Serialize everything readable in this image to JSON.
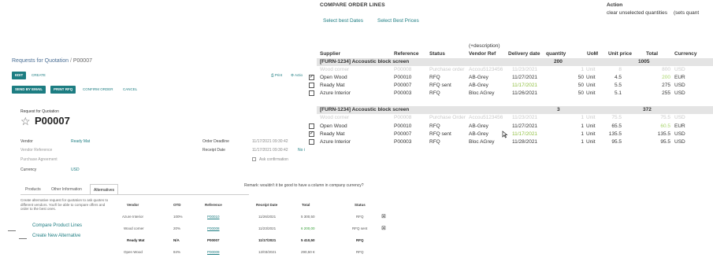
{
  "form": {
    "breadcrumb_parent": "Requests for Quotation",
    "breadcrumb_sep": " / ",
    "breadcrumb_current": "P00007",
    "buttons": {
      "edit": "EDIT",
      "create": "CREATE",
      "send_email": "SEND BY EMAIL",
      "print_rfq": "PRINT RFQ",
      "confirm": "CONFIRM ORDER",
      "cancel": "CANCEL",
      "print": "⎙ Print",
      "action": "⚙ Actio"
    },
    "title_small": "Request for Quotation",
    "title": "P00007",
    "fields": {
      "vendor_label": "Vendor",
      "vendor_value": "Ready Mat",
      "vendor_ref_label": "Vendor Reference",
      "agreement_label": "Purchase Agreement",
      "currency_label": "Currency",
      "currency_value": "USD",
      "deadline_label": "Order Deadline",
      "deadline_value": "11/17/2021 09:30:42",
      "receipt_label": "Receipt Date",
      "receipt_value": "11/17/2021 09:30:42",
      "receipt_extra": "No i",
      "ask_confirm": "Ask confirmation"
    },
    "tabs": [
      "Products",
      "Other Information",
      "Alternatives"
    ],
    "remark": "Remark: wouldn't it be good to have a column in company currency?",
    "note": "Create alternative request for quotation to ask quotes to different vendors. You'll be able to compare offers and order to the best ones.",
    "compare_link": "Compare Product Lines",
    "create_alt_link": "Create New Alternative",
    "alt_table": {
      "headers": [
        "Vendor",
        "OTD",
        "Reference",
        "Receipt Date",
        "Total",
        "Status"
      ],
      "rows": [
        [
          "Azure Interior",
          "100%",
          "P00010",
          "11/26/2021",
          "5 300,50",
          "RFQ"
        ],
        [
          "Wood corner",
          "20%",
          "P00008",
          "11/23/2021",
          "6 200,00",
          "RFQ sent"
        ],
        [
          "Ready Mat",
          "N/A",
          "P00007",
          "11/17/2021",
          "5 410,50",
          "RFQ"
        ],
        [
          "Open Wood",
          "84%",
          "P00009",
          "12/03/2021",
          "290,50 €",
          "RFQ"
        ]
      ]
    }
  },
  "compare": {
    "title": "COMPARE ORDER LINES",
    "action_label": "Action",
    "action_text": "clear unselected quantities",
    "action_text2": "(sets quant",
    "select_best_dates": "Select best Dates",
    "select_best_prices": "Select Best Prices",
    "description_hint": "(+description)",
    "headers": [
      "Supplier",
      "Reference",
      "Status",
      "Vendor Ref",
      "Delivery date",
      "quantity",
      "UoM",
      "Unit price",
      "Total",
      "Currency"
    ],
    "groups": [
      {
        "product": "[FURN-1234] Accoustic block screen",
        "qty": "200",
        "total": "1005",
        "faded": [
          "Wood corner",
          "P00008",
          "Purchase order",
          "Accou5123456",
          "11/23/2021",
          "1",
          "Unit",
          "8",
          "800",
          "USD"
        ],
        "lines": [
          {
            "checked": true,
            "supplier": "Open Wood",
            "ref": "P00010",
            "status": "RFQ",
            "vref": "AB-Grey",
            "date": "11/27/2021",
            "qty": "50",
            "uom": "Unit",
            "price": "4.5",
            "total": "200",
            "currency": "EUR",
            "date_hl": false,
            "total_hl": true
          },
          {
            "checked": false,
            "supplier": "Ready Mat",
            "ref": "P00007",
            "status": "RFQ sent",
            "vref": "AB-Grey",
            "date": "11/17/2021",
            "qty": "50",
            "uom": "Unit",
            "price": "5.5",
            "total": "275",
            "currency": "USD",
            "date_hl": true,
            "total_hl": false
          },
          {
            "checked": false,
            "supplier": "Azure Interior",
            "ref": "P00003",
            "status": "RFQ",
            "vref": "Bloc AGrey",
            "date": "11/26/2021",
            "qty": "50",
            "uom": "Unit",
            "price": "5.1",
            "total": "255",
            "currency": "USD",
            "date_hl": false,
            "total_hl": false
          }
        ]
      },
      {
        "product": "[FURN-1234] Accoustic block screen",
        "qty": "3",
        "total": "372",
        "faded": [
          "Wood corner",
          "P00008",
          "Purchase Order",
          "Accou5123456",
          "11/23/2021",
          "1",
          "Unit",
          "75.5",
          "75.5",
          "USD"
        ],
        "lines": [
          {
            "checked": false,
            "supplier": "Open Wood",
            "ref": "P00010",
            "status": "RFQ",
            "vref": "AB-Grey",
            "date": "11/27/2021",
            "qty": "1",
            "uom": "Unit",
            "price": "65.5",
            "total": "60.5",
            "currency": "EUR",
            "date_hl": false,
            "total_hl": true
          },
          {
            "checked": true,
            "supplier": "Ready Mat",
            "ref": "P00007",
            "status": "RFQ sent",
            "vref": "AB-Grey",
            "date": "11/17/2021",
            "qty": "1",
            "uom": "Unit",
            "price": "135.5",
            "total": "135.5",
            "currency": "USD",
            "date_hl": true,
            "total_hl": false
          },
          {
            "checked": false,
            "supplier": "Azure Interior",
            "ref": "P00003",
            "status": "RFQ",
            "vref": "Bloc AGrey",
            "date": "11/28/2021",
            "qty": "1",
            "uom": "Unit",
            "price": "95.5",
            "total": "95.5",
            "currency": "USD",
            "date_hl": false,
            "total_hl": false
          }
        ]
      }
    ]
  },
  "colors": {
    "accent": "#1d7d82",
    "group_bg": "#e4e4e4",
    "highlight_green": "#8fbf3f"
  }
}
